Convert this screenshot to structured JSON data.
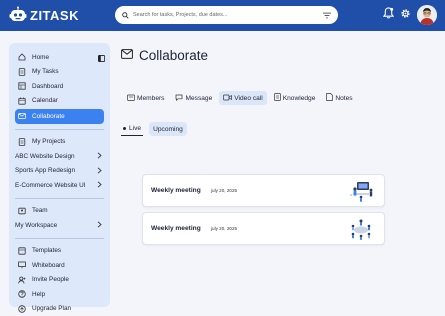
{
  "app": {
    "name": "ZITASK"
  },
  "search": {
    "placeholder": "Search for tasks, Projects, due dates..."
  },
  "icons": {
    "logo": "robot-logo-icon",
    "search": "search-icon",
    "filter": "filter-icon",
    "bell": "bell-icon",
    "settings": "gear-icon",
    "collapse": "sidebar-collapse-icon"
  },
  "colors": {
    "topbar": "#1f4fa8",
    "accent": "#3b82f0",
    "sidebar": "#dde8fb"
  },
  "sidebar": {
    "primary": [
      {
        "label": "Home",
        "icon": "home-icon"
      },
      {
        "label": "My Tasks",
        "icon": "tasks-icon"
      },
      {
        "label": "Dashboard",
        "icon": "dashboard-icon"
      },
      {
        "label": "Calendar",
        "icon": "calendar-icon"
      },
      {
        "label": "Collaborate",
        "icon": "collaborate-icon",
        "active": true
      }
    ],
    "projects_label": "My Projects",
    "projects": [
      "ABC Website Design",
      "Sports App Redesign",
      "E-Commerce Website UI"
    ],
    "team_label": "Team",
    "workspace_label": "My Workspace",
    "tools": [
      {
        "label": "Templates",
        "icon": "templates-icon"
      },
      {
        "label": "Whiteboard",
        "icon": "whiteboard-icon"
      },
      {
        "label": "Invite People",
        "icon": "invite-icon"
      },
      {
        "label": "Help",
        "icon": "help-icon"
      },
      {
        "label": "Upgrade Plan",
        "icon": "upgrade-icon"
      }
    ]
  },
  "page": {
    "title": "Collaborate",
    "icon": "mail-icon"
  },
  "tabs": [
    {
      "label": "Members",
      "icon": "members-icon"
    },
    {
      "label": "Message",
      "icon": "message-icon"
    },
    {
      "label": "Video call",
      "icon": "video-icon",
      "active": true
    },
    {
      "label": "Knowledge",
      "icon": "knowledge-icon"
    },
    {
      "label": "Notes",
      "icon": "notes-icon"
    }
  ],
  "subtabs": {
    "live": "Live",
    "upcoming": "Upcoming"
  },
  "meetings": [
    {
      "title": "Weekly meeting",
      "date": "july 20, 2025"
    },
    {
      "title": "Weekly meeting",
      "date": "july 20, 2025"
    }
  ]
}
